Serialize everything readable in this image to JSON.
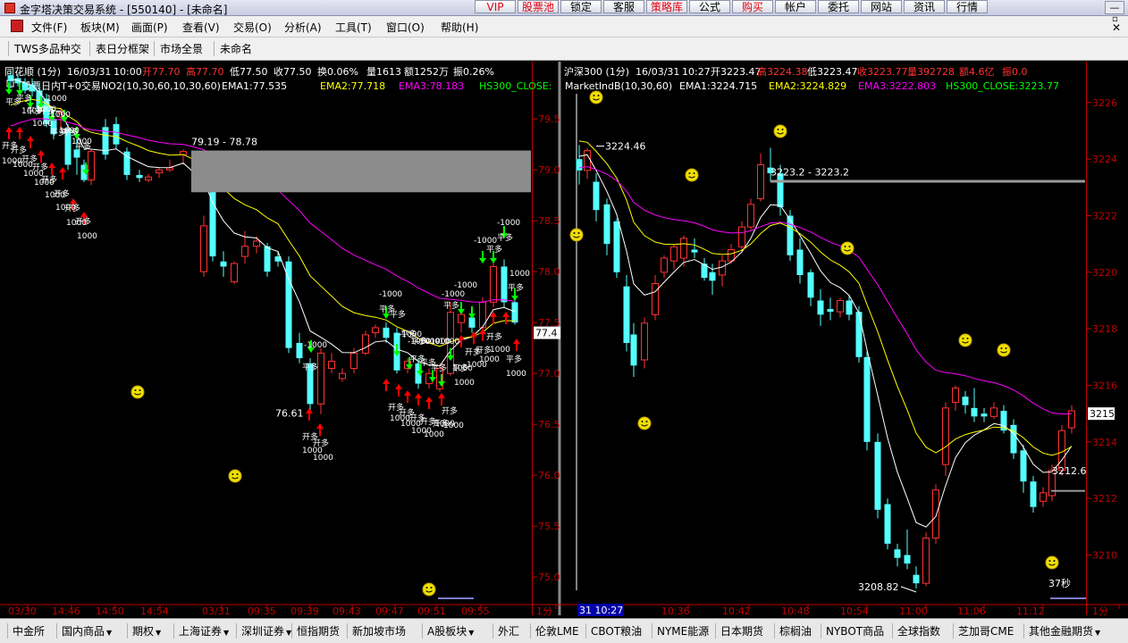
{
  "window": {
    "title": "金字塔决策交易系统 - [550140] - [未命名]",
    "minimize": "—"
  },
  "quickbar": [
    {
      "label": "VIP",
      "red": true
    },
    {
      "label": "股票池",
      "red": true
    },
    {
      "label": "锁定",
      "red": false
    },
    {
      "label": "客服",
      "red": false
    },
    {
      "label": "策略库",
      "red": true
    },
    {
      "label": "公式",
      "red": false
    },
    {
      "label": "购买",
      "red": true
    },
    {
      "label": "帐户",
      "red": false
    },
    {
      "label": "委托",
      "red": false
    },
    {
      "label": "网站",
      "red": false
    },
    {
      "label": "资讯",
      "red": false
    },
    {
      "label": "行情",
      "red": false
    }
  ],
  "menu": [
    "文件(F)",
    "板块(M)",
    "画面(P)",
    "查看(V)",
    "交易(O)",
    "分析(A)",
    "工具(T)",
    "窗口(O)",
    "帮助(H)"
  ],
  "toolbar": [
    "TWS多品种交",
    "表日分框架",
    "市场全景",
    "未命名"
  ],
  "left_chart": {
    "header": {
      "name": "同花顺 (1分)",
      "date": "16/03/31",
      "time": "10:00",
      "open": "开77.70",
      "high": "高77.70",
      "low": "低77.50",
      "close": "收77.50",
      "turnover": "换0.06%",
      "volume": "量1613",
      "amount": "额1252万",
      "amplitude": "振0.26%"
    },
    "indicator": {
      "name": "股票日内T+0交易NO2(10,30,60,10,30,60)",
      "ema1": "EMA1:77.535",
      "ema2": "EMA2:77.718",
      "ema3": "EMA3:78.183",
      "hs300": "HS300_CLOSE:"
    },
    "price_axis": [
      "79.5",
      "79.0",
      "78.5",
      "78.0",
      "77.5",
      "77.0",
      "76.5",
      "76.0",
      "75.5",
      "75.0"
    ],
    "price_marker": "77.4",
    "range_label": "79.19 - 78.78",
    "low_label": "76.61",
    "time_axis": [
      "03/30",
      "14:46",
      "14:50",
      "14:54",
      "03/31",
      "09:35",
      "09:39",
      "09:43",
      "09:47",
      "09:51",
      "09:55",
      "1分"
    ],
    "signals": {
      "open_long": "开多",
      "close_long": "平多",
      "qty": "1000",
      "qty_neg": "-1000"
    },
    "ylim": [
      74.8,
      79.8
    ]
  },
  "right_chart": {
    "header": {
      "name": "沪深300 (1分)",
      "date": "16/03/31",
      "time": "10:27",
      "open": "开3223.47",
      "high": "高3224.38",
      "low": "低3223.47",
      "close": "收3223.77",
      "volume": "量392728",
      "amount": "额4.6亿",
      "amplitude": "振0.0"
    },
    "indicator": {
      "name": "MarketIndB(10,30,60)",
      "ema1": "EMA1:3224.715",
      "ema2": "EMA2:3224.829",
      "ema3": "EMA3:3222.803",
      "hs300": "HS300_CLOSE:3223.77"
    },
    "price_axis": [
      "3226",
      "3224",
      "3222",
      "3220",
      "3218",
      "3216",
      "3214",
      "3212",
      "3210"
    ],
    "price_marker": "3215",
    "high_label": "3224.46",
    "range_label": "3223.2 - 3223.2",
    "low_label": "3208.82",
    "last_label": "3212.6",
    "countdown": "37秒",
    "cursor_time": "31 10:27",
    "time_axis": [
      "10:36",
      "10:42",
      "10:48",
      "10:54",
      "11:00",
      "11:06",
      "11:12",
      "1分"
    ],
    "ylim": [
      3208.5,
      3226.5
    ]
  },
  "bottom_tabs": [
    "中金所",
    "国内商品",
    "期权",
    "上海证券",
    "深圳证券",
    "恒指期货",
    "新加坡市场",
    "A股板块",
    "外汇",
    "伦敦LME",
    "CBOT粮油",
    "NYME能源",
    "日本期货",
    "棕榈油",
    "NYBOT商品",
    "全球指数",
    "芝加哥CME",
    "其他金融期货"
  ],
  "colors": {
    "bg": "#000000",
    "up": "#ff3232",
    "down": "#54ffff",
    "ema1": "#ffffff",
    "ema2": "#ffff00",
    "ema3": "#ff00ff",
    "axis": "#c00000",
    "buy": "#ff0000",
    "sell": "#00ff00"
  }
}
